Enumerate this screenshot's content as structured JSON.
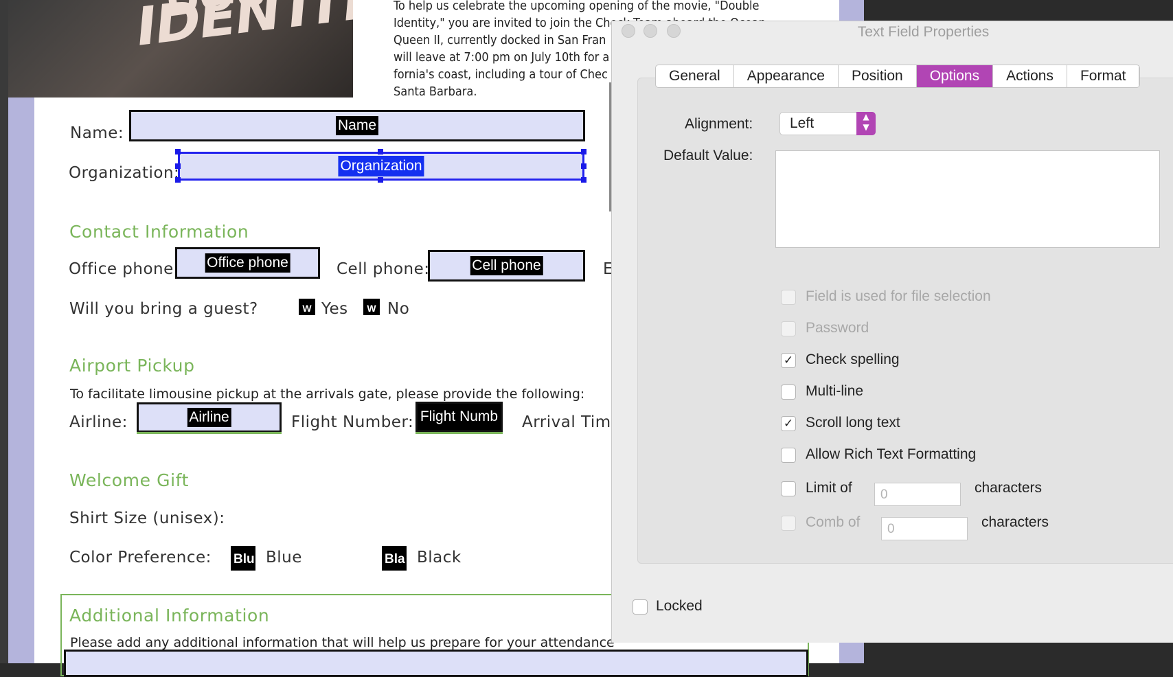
{
  "poster": {
    "title": "IDENTITY",
    "title_top": "DOU"
  },
  "intro_lines": [
    "To help us celebrate the upcoming opening of the movie, \"Double",
    "Identity,\" you are invited to join the Check Team aboard the Ocean",
    "Queen II, currently docked in San Fran",
    "will leave at 7:00 pm on July 10th for a",
    "fornia's coast, including a tour of Chec",
    "Santa Barbara."
  ],
  "form": {
    "name_label": "Name:",
    "name_field": "Name",
    "org_label": "Organization:",
    "org_field": "Organization",
    "contact_heading": "Contact Information",
    "office_label": "Office phone:",
    "office_field": "Office phone",
    "cell_label": "Cell phone:",
    "cell_field": "Cell phone",
    "email_initial": "E",
    "guest_label": "Will you bring a guest?",
    "guest_yes": "Yes",
    "guest_no": "No",
    "guest_box_glyph": "W",
    "airport_heading": "Airport Pickup",
    "airport_text": "To facilitate limousine pickup at the arrivals gate, please provide the following:",
    "airline_label": "Airline:",
    "airline_field": "Airline",
    "flight_label": "Flight Number:",
    "flight_field": "Flight Numb",
    "arrival_label": "Arrival Time",
    "gift_heading": "Welcome Gift",
    "shirt_label": "Shirt Size (unisex):",
    "color_label": "Color Preference:",
    "blue_box": "Blu",
    "blue_label": "Blue",
    "black_box": "Bla",
    "black_label": "Black",
    "additional_heading": "Additional Information",
    "additional_text": "Please add any additional information that will help us prepare for your attendance"
  },
  "dialog": {
    "title": "Text Field Properties",
    "tabs": [
      "General",
      "Appearance",
      "Position",
      "Options",
      "Actions",
      "Format"
    ],
    "active_tab": "Options",
    "alignment_label": "Alignment:",
    "alignment_value": "Left",
    "default_value_label": "Default Value:",
    "default_value": "",
    "options": [
      {
        "label": "Field is used for file selection",
        "checked": false,
        "enabled": false
      },
      {
        "label": "Password",
        "checked": false,
        "enabled": false
      },
      {
        "label": "Check spelling",
        "checked": true,
        "enabled": true
      },
      {
        "label": "Multi-line",
        "checked": false,
        "enabled": true
      },
      {
        "label": "Scroll long text",
        "checked": true,
        "enabled": true
      },
      {
        "label": "Allow Rich Text Formatting",
        "checked": false,
        "enabled": true
      }
    ],
    "limit_label": "Limit of",
    "limit_value": "0",
    "limit_suffix": "characters",
    "comb_label": "Comb of",
    "comb_value": "0",
    "comb_suffix": "characters",
    "locked_label": "Locked",
    "check_glyph": "✓"
  },
  "colors": {
    "accent": "#b145b4",
    "section_green": "#7ab55a",
    "field_fill": "#dde0f8",
    "selection_blue": "#1430f0"
  }
}
